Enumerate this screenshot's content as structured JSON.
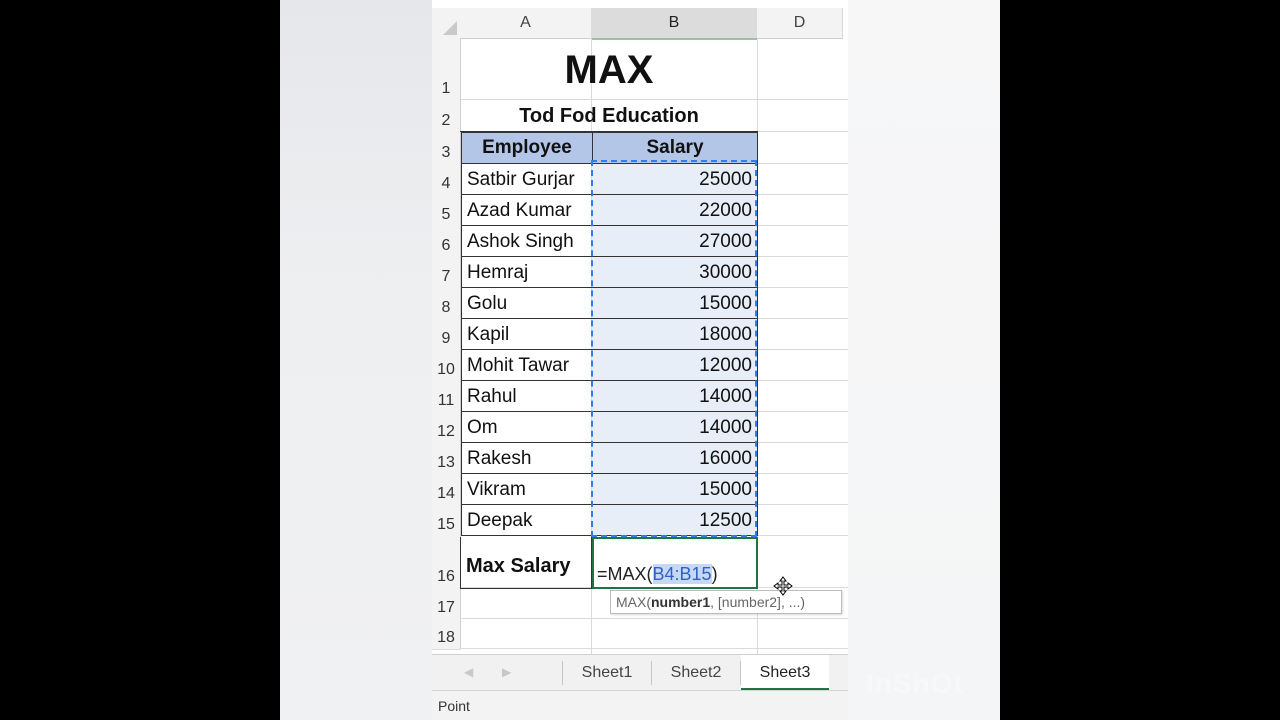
{
  "columns": [
    "A",
    "B",
    "D"
  ],
  "rows": [
    "1",
    "2",
    "3",
    "4",
    "5",
    "6",
    "7",
    "8",
    "9",
    "10",
    "11",
    "12",
    "13",
    "14",
    "15",
    "16",
    "17",
    "18"
  ],
  "sheet": {
    "title": "MAX",
    "subtitle": "Tod Fod Education",
    "headers": {
      "employee": "Employee",
      "salary": "Salary"
    },
    "data": [
      {
        "name": "Satbir Gurjar",
        "salary": "25000"
      },
      {
        "name": "Azad Kumar",
        "salary": "22000"
      },
      {
        "name": "Ashok Singh",
        "salary": "27000"
      },
      {
        "name": "Hemraj",
        "salary": "30000"
      },
      {
        "name": "Golu",
        "salary": "15000"
      },
      {
        "name": "Kapil",
        "salary": "18000"
      },
      {
        "name": "Mohit Tawar",
        "salary": "12000"
      },
      {
        "name": "Rahul",
        "salary": "14000"
      },
      {
        "name": "Om",
        "salary": "14000"
      },
      {
        "name": "Rakesh",
        "salary": "16000"
      },
      {
        "name": "Vikram",
        "salary": "15000"
      },
      {
        "name": "Deepak",
        "salary": "12500"
      }
    ],
    "max_label": "Max Salary",
    "formula": {
      "prefix": "=MAX(",
      "range": "B4:B15",
      "suffix": ")"
    },
    "tooltip": {
      "fn": "MAX(",
      "arg1": "number1",
      "rest": ", [number2], ...)"
    }
  },
  "tabs": [
    "Sheet1",
    "Sheet2",
    "Sheet3"
  ],
  "active_tab": "Sheet3",
  "status": "Point",
  "watermark": "InShOt",
  "colors": {
    "header_fill": "#b4c6e7",
    "range_fill": "#e8eef8",
    "marquee": "#2e7df0",
    "excel_green": "#217346"
  }
}
